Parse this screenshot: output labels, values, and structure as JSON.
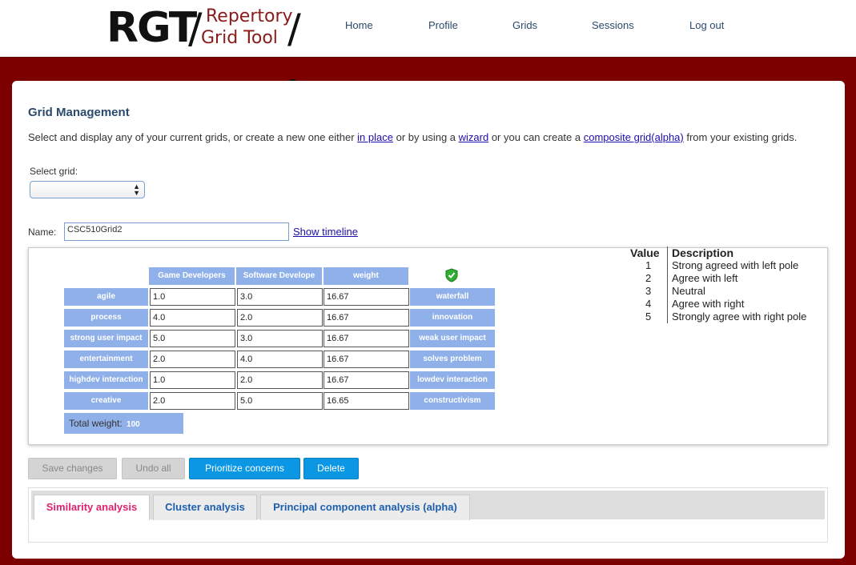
{
  "logo": {
    "short": "RGT",
    "line1": "Repertory",
    "line2": "Grid Tool",
    "slash": "/"
  },
  "nav": [
    "Home",
    "Profile",
    "Grids",
    "Sessions",
    "Log out"
  ],
  "page": {
    "title": "Grid Management",
    "intro_1": "Select and display any of your current grids, or create a new one either ",
    "link_inplace": "in place",
    "intro_2": " or by using a ",
    "link_wizard": "wizard",
    "intro_3": " or you can create a ",
    "link_composite": "composite grid(alpha)",
    "intro_4": " from your existing grids.",
    "select_label": "Select grid:",
    "select_value": "",
    "name_label": "Name:",
    "name_value": "CSC510Grid2",
    "show_timeline": "Show timeline"
  },
  "grid": {
    "columns": [
      "Game Developers",
      "Software Develope",
      "weight"
    ],
    "rows": [
      {
        "left": "agile",
        "v1": "1.0",
        "v2": "3.0",
        "w": "16.67",
        "right": "waterfall"
      },
      {
        "left": "process",
        "v1": "4.0",
        "v2": "2.0",
        "w": "16.67",
        "right": "innovation"
      },
      {
        "left": "strong user impact",
        "v1": "5.0",
        "v2": "3.0",
        "w": "16.67",
        "right": "weak user impact"
      },
      {
        "left": "entertainment",
        "v1": "2.0",
        "v2": "4.0",
        "w": "16.67",
        "right": "solves problem"
      },
      {
        "left": "highdev interaction",
        "v1": "1.0",
        "v2": "2.0",
        "w": "16.67",
        "right": "lowdev interaction"
      },
      {
        "left": "creative",
        "v1": "2.0",
        "v2": "5.0",
        "w": "16.65",
        "right": "constructivism"
      }
    ],
    "total_label": "Total weight:",
    "total_value": "100"
  },
  "legend": {
    "value_header": "Value",
    "desc_header": "Description",
    "items": [
      {
        "value": "1",
        "desc": "Strong agreed with left pole"
      },
      {
        "value": "2",
        "desc": "Agree with left"
      },
      {
        "value": "3",
        "desc": "Neutral"
      },
      {
        "value": "4",
        "desc": "Agree with right"
      },
      {
        "value": "5",
        "desc": "Strongly agree with right pole"
      }
    ]
  },
  "buttons": {
    "save": "Save changes",
    "undo": "Undo all",
    "prioritize": "Prioritize concerns",
    "delete": "Delete"
  },
  "tabs": [
    "Similarity analysis",
    "Cluster analysis",
    "Principal component analysis (alpha)"
  ],
  "colors": {
    "brand": "#7c0000",
    "cell": "#8fb0e8",
    "button": "#0b97e3",
    "active_tab": "#e0216f"
  },
  "icons": {
    "valid": "green-shield-check-icon"
  }
}
